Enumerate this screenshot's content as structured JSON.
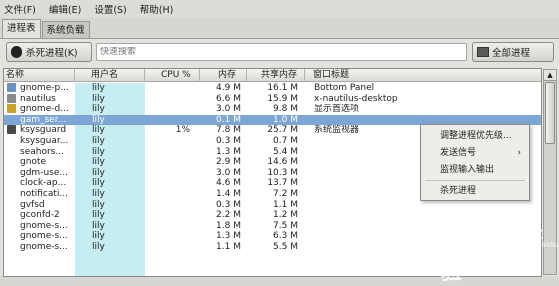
{
  "menubar": {
    "items": [
      "文件(F)",
      "编辑(E)",
      "设置(S)",
      "帮助(H)"
    ]
  },
  "tabs": [
    {
      "label": "进程表",
      "active": true
    },
    {
      "label": "系统负载",
      "active": false
    }
  ],
  "toolbar": {
    "kill_label": "杀死进程(K)",
    "search_placeholder": "快速搜索",
    "filter_label": "全部进程"
  },
  "columns": [
    "名称",
    "用户名",
    "CPU %",
    "内存",
    "共享内存",
    "窗口标题"
  ],
  "rows": [
    {
      "name": "gnome-p...",
      "user": "lily",
      "cpu": "",
      "mem": "4.9 M",
      "shared": "16.1 M",
      "title": "Bottom Panel",
      "icon": "panel"
    },
    {
      "name": "nautilus",
      "user": "lily",
      "cpu": "",
      "mem": "6.6 M",
      "shared": "15.9 M",
      "title": "x-nautilus-desktop",
      "icon": "files"
    },
    {
      "name": "gnome-d...",
      "user": "lily",
      "cpu": "",
      "mem": "3.0 M",
      "shared": "9.8 M",
      "title": "显示首选项",
      "icon": "display"
    },
    {
      "name": "gam_ser...",
      "user": "lily",
      "cpu": "",
      "mem": "0.1 M",
      "shared": "1.0 M",
      "title": "",
      "icon": "",
      "selected": true
    },
    {
      "name": "ksysguard",
      "user": "lily",
      "cpu": "1%",
      "mem": "7.8 M",
      "shared": "25.7 M",
      "title": "系统监视器",
      "icon": "monitor"
    },
    {
      "name": "ksysguar...",
      "user": "lily",
      "cpu": "",
      "mem": "0.3 M",
      "shared": "0.7 M",
      "title": "",
      "icon": ""
    },
    {
      "name": "seahors...",
      "user": "lily",
      "cpu": "",
      "mem": "1.3 M",
      "shared": "5.4 M",
      "title": "",
      "icon": ""
    },
    {
      "name": "gnote",
      "user": "lily",
      "cpu": "",
      "mem": "2.9 M",
      "shared": "14.6 M",
      "title": "",
      "icon": ""
    },
    {
      "name": "gdm-use...",
      "user": "lily",
      "cpu": "",
      "mem": "3.0 M",
      "shared": "10.3 M",
      "title": "",
      "icon": ""
    },
    {
      "name": "clock-ap...",
      "user": "lily",
      "cpu": "",
      "mem": "4.6 M",
      "shared": "13.7 M",
      "title": "",
      "icon": ""
    },
    {
      "name": "notificati...",
      "user": "lily",
      "cpu": "",
      "mem": "1.4 M",
      "shared": "7.2 M",
      "title": "",
      "icon": ""
    },
    {
      "name": "gvfsd",
      "user": "lily",
      "cpu": "",
      "mem": "0.3 M",
      "shared": "1.1 M",
      "title": "",
      "icon": ""
    },
    {
      "name": "gconfd-2",
      "user": "lily",
      "cpu": "",
      "mem": "2.2 M",
      "shared": "1.2 M",
      "title": "",
      "icon": ""
    },
    {
      "name": "gnome-s...",
      "user": "lily",
      "cpu": "",
      "mem": "1.8 M",
      "shared": "7.5 M",
      "title": "",
      "icon": ""
    },
    {
      "name": "gnome-s...",
      "user": "lily",
      "cpu": "",
      "mem": "1.3 M",
      "shared": "6.3 M",
      "title": "",
      "icon": ""
    },
    {
      "name": "gnome-s...",
      "user": "lily",
      "cpu": "",
      "mem": "1.1 M",
      "shared": "5.5 M",
      "title": "",
      "icon": ""
    }
  ],
  "context_menu": {
    "items": [
      "调整进程优先级...",
      "发送信号",
      "监视输入输出",
      "杀死进程"
    ]
  },
  "watermark": {
    "brand": "Baidu 经验",
    "url": "jingyan.baidu.com"
  },
  "colors": {
    "selection": "#7ba6d6",
    "user_column": "#c6eef2"
  }
}
